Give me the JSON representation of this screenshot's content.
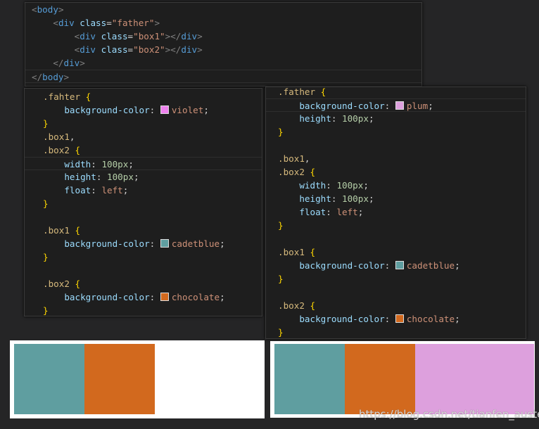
{
  "html_panel": {
    "lines": [
      [
        [
          "punc",
          "<"
        ],
        [
          "tag",
          "body"
        ],
        [
          "punc",
          ">"
        ]
      ],
      [
        [
          "plain",
          "    "
        ],
        [
          "punc",
          "<"
        ],
        [
          "tag",
          "div "
        ],
        [
          "attr",
          "class"
        ],
        [
          "plain",
          "="
        ],
        [
          "str",
          "\"father\""
        ],
        [
          "punc",
          ">"
        ]
      ],
      [
        [
          "plain",
          "        "
        ],
        [
          "punc",
          "<"
        ],
        [
          "tag",
          "div "
        ],
        [
          "attr",
          "class"
        ],
        [
          "plain",
          "="
        ],
        [
          "str",
          "\"box1\""
        ],
        [
          "punc",
          "></"
        ],
        [
          "tag",
          "div"
        ],
        [
          "punc",
          ">"
        ]
      ],
      [
        [
          "plain",
          "        "
        ],
        [
          "punc",
          "<"
        ],
        [
          "tag",
          "div "
        ],
        [
          "attr",
          "class"
        ],
        [
          "plain",
          "="
        ],
        [
          "str",
          "\"box2\""
        ],
        [
          "punc",
          "></"
        ],
        [
          "tag",
          "div"
        ],
        [
          "punc",
          ">"
        ]
      ],
      [
        [
          "plain",
          "    "
        ],
        [
          "punc",
          "</"
        ],
        [
          "tag",
          "div"
        ],
        [
          "punc",
          ">"
        ]
      ],
      [
        [
          "punc",
          "</"
        ],
        [
          "tag",
          "body"
        ],
        [
          "punc",
          ">"
        ]
      ]
    ]
  },
  "css_left": {
    "lines": [
      [
        [
          "sel",
          ".fahter "
        ],
        [
          "brace",
          "{"
        ]
      ],
      [
        [
          "plain",
          "    "
        ],
        [
          "prop",
          "background-color"
        ],
        [
          "plain",
          ": "
        ],
        [
          "swatch",
          "#ee82ee"
        ],
        [
          "val",
          "violet"
        ],
        [
          "plain",
          ";"
        ]
      ],
      [
        [
          "brace",
          "}"
        ]
      ],
      [
        [
          "sel",
          ".box1"
        ],
        [
          "plain",
          ","
        ]
      ],
      [
        [
          "sel",
          ".box2 "
        ],
        [
          "brace",
          "{"
        ]
      ],
      [
        [
          "plain",
          "    "
        ],
        [
          "prop",
          "width"
        ],
        [
          "plain",
          ": "
        ],
        [
          "num",
          "100px"
        ],
        [
          "plain",
          ";"
        ]
      ],
      [
        [
          "plain",
          "    "
        ],
        [
          "prop",
          "height"
        ],
        [
          "plain",
          ": "
        ],
        [
          "num",
          "100px"
        ],
        [
          "plain",
          ";"
        ]
      ],
      [
        [
          "plain",
          "    "
        ],
        [
          "prop",
          "float"
        ],
        [
          "plain",
          ": "
        ],
        [
          "val",
          "left"
        ],
        [
          "plain",
          ";"
        ]
      ],
      [
        [
          "brace",
          "}"
        ]
      ],
      [],
      [
        [
          "sel",
          ".box1 "
        ],
        [
          "brace",
          "{"
        ]
      ],
      [
        [
          "plain",
          "    "
        ],
        [
          "prop",
          "background-color"
        ],
        [
          "plain",
          ": "
        ],
        [
          "swatch",
          "#5f9ea0"
        ],
        [
          "val",
          "cadetblue"
        ],
        [
          "plain",
          ";"
        ]
      ],
      [
        [
          "brace",
          "}"
        ]
      ],
      [],
      [
        [
          "sel",
          ".box2 "
        ],
        [
          "brace",
          "{"
        ]
      ],
      [
        [
          "plain",
          "    "
        ],
        [
          "prop",
          "background-color"
        ],
        [
          "plain",
          ": "
        ],
        [
          "swatch",
          "#d2691e"
        ],
        [
          "val",
          "chocolate"
        ],
        [
          "plain",
          ";"
        ]
      ],
      [
        [
          "brace",
          "}"
        ]
      ]
    ]
  },
  "css_right": {
    "lines": [
      [
        [
          "sel",
          ".father "
        ],
        [
          "brace",
          "{"
        ]
      ],
      [
        [
          "plain",
          "    "
        ],
        [
          "prop",
          "background-color"
        ],
        [
          "plain",
          ": "
        ],
        [
          "swatch",
          "#dda0dd"
        ],
        [
          "val",
          "plum"
        ],
        [
          "plain",
          ";"
        ]
      ],
      [
        [
          "plain",
          "    "
        ],
        [
          "prop",
          "height"
        ],
        [
          "plain",
          ": "
        ],
        [
          "num",
          "100px"
        ],
        [
          "plain",
          ";"
        ]
      ],
      [
        [
          "brace",
          "}"
        ]
      ],
      [],
      [
        [
          "sel",
          ".box1"
        ],
        [
          "plain",
          ","
        ]
      ],
      [
        [
          "sel",
          ".box2 "
        ],
        [
          "brace",
          "{"
        ]
      ],
      [
        [
          "plain",
          "    "
        ],
        [
          "prop",
          "width"
        ],
        [
          "plain",
          ": "
        ],
        [
          "num",
          "100px"
        ],
        [
          "plain",
          ";"
        ]
      ],
      [
        [
          "plain",
          "    "
        ],
        [
          "prop",
          "height"
        ],
        [
          "plain",
          ": "
        ],
        [
          "num",
          "100px"
        ],
        [
          "plain",
          ";"
        ]
      ],
      [
        [
          "plain",
          "    "
        ],
        [
          "prop",
          "float"
        ],
        [
          "plain",
          ": "
        ],
        [
          "val",
          "left"
        ],
        [
          "plain",
          ";"
        ]
      ],
      [
        [
          "brace",
          "}"
        ]
      ],
      [],
      [
        [
          "sel",
          ".box1 "
        ],
        [
          "brace",
          "{"
        ]
      ],
      [
        [
          "plain",
          "    "
        ],
        [
          "prop",
          "background-color"
        ],
        [
          "plain",
          ": "
        ],
        [
          "swatch",
          "#5f9ea0"
        ],
        [
          "val",
          "cadetblue"
        ],
        [
          "plain",
          ";"
        ]
      ],
      [
        [
          "brace",
          "}"
        ]
      ],
      [],
      [
        [
          "sel",
          ".box2 "
        ],
        [
          "brace",
          "{"
        ]
      ],
      [
        [
          "plain",
          "    "
        ],
        [
          "prop",
          "background-color"
        ],
        [
          "plain",
          ": "
        ],
        [
          "swatch",
          "#d2691e"
        ],
        [
          "val",
          "chocolate"
        ],
        [
          "plain",
          ";"
        ]
      ],
      [
        [
          "brace",
          "}"
        ]
      ]
    ]
  },
  "colors": {
    "cadetblue": "#5f9ea0",
    "chocolate": "#d2691e",
    "plum": "#dda0dd"
  },
  "watermark": "https://blog.csdn.net/tianfen_auster"
}
